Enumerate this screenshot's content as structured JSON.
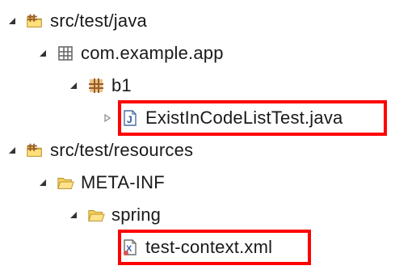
{
  "colors": {
    "highlight": "#ff0000",
    "folder": "#f0c040",
    "package": "#b07a3a",
    "expander": "#333333"
  },
  "tree": {
    "nodes": [
      {
        "label": "src/test/java",
        "icon": "source-folder-icon",
        "expanded": true
      },
      {
        "label": "com.example.app",
        "icon": "package-empty-icon",
        "expanded": true
      },
      {
        "label": "b1",
        "icon": "package-icon",
        "expanded": true
      },
      {
        "label": "ExistInCodeListTest.java",
        "icon": "java-file-icon",
        "expanded": false,
        "highlighted": true
      },
      {
        "label": "src/test/resources",
        "icon": "source-folder-icon",
        "expanded": true
      },
      {
        "label": "META-INF",
        "icon": "folder-open-icon",
        "expanded": true
      },
      {
        "label": "spring",
        "icon": "folder-open-icon",
        "expanded": true
      },
      {
        "label": "test-context.xml",
        "icon": "xml-file-icon",
        "highlighted": true
      }
    ]
  }
}
